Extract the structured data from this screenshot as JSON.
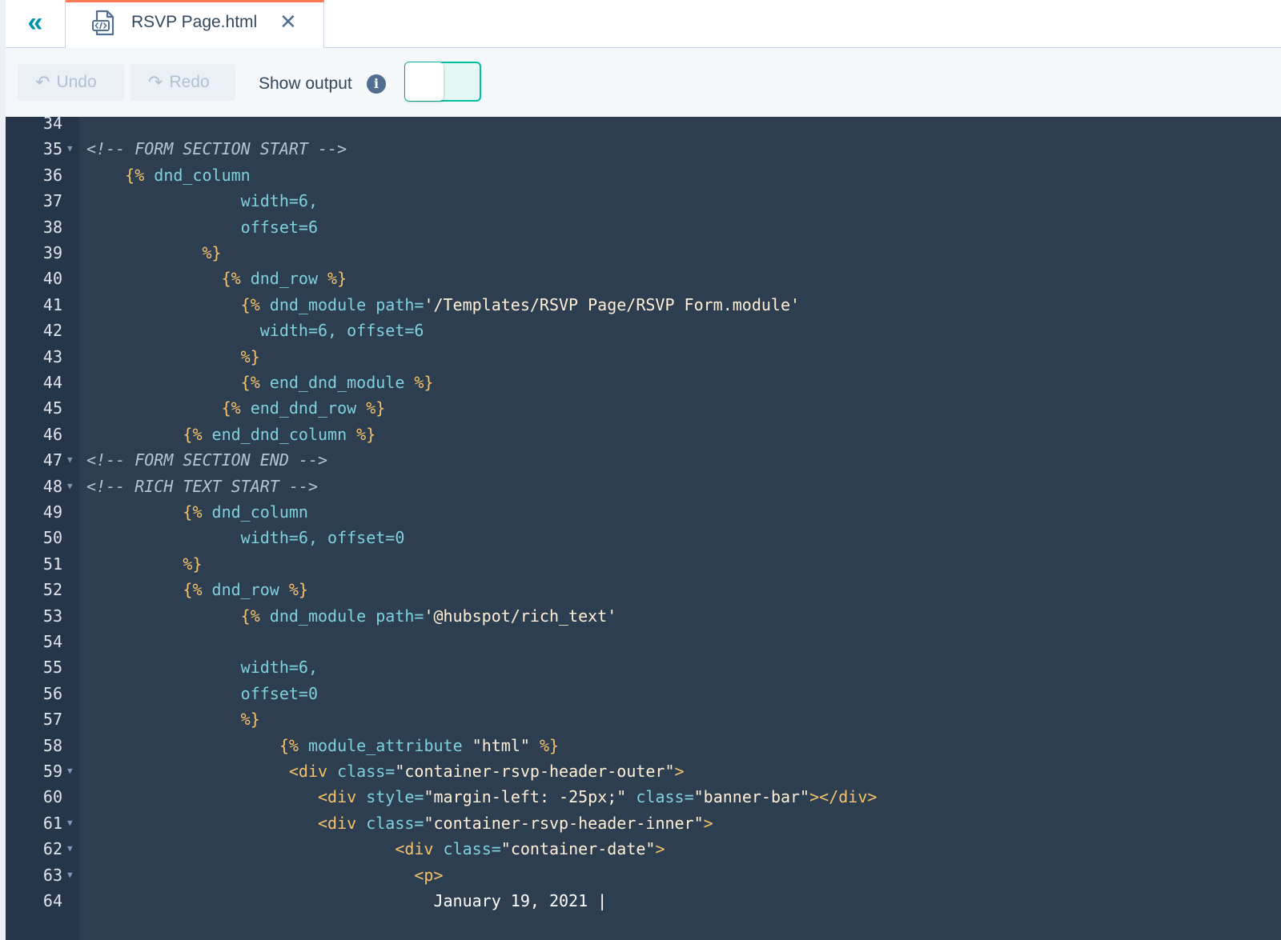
{
  "tab": {
    "title": "RSVP Page.html",
    "close_glyph": "✕",
    "collapse_glyph": "«"
  },
  "toolbar": {
    "undo_label": "Undo",
    "redo_label": "Redo",
    "show_output_label": "Show output",
    "toggle_on": false
  },
  "editor": {
    "lines": [
      {
        "n": "34",
        "fold": false,
        "tokens": []
      },
      {
        "n": "35",
        "fold": true,
        "tokens": [
          {
            "t": "<!-- FORM SECTION START -->",
            "c": "comment"
          }
        ]
      },
      {
        "n": "36",
        "fold": false,
        "tokens": [
          {
            "t": "    {% ",
            "c": "tag"
          },
          {
            "t": "dnd_column",
            "c": "attr"
          }
        ]
      },
      {
        "n": "37",
        "fold": false,
        "tokens": [
          {
            "t": "                width=6,",
            "c": "attr"
          }
        ]
      },
      {
        "n": "38",
        "fold": false,
        "tokens": [
          {
            "t": "                offset=6",
            "c": "attr"
          }
        ]
      },
      {
        "n": "39",
        "fold": false,
        "tokens": [
          {
            "t": "            %}",
            "c": "tag"
          }
        ]
      },
      {
        "n": "40",
        "fold": false,
        "tokens": [
          {
            "t": "              {% ",
            "c": "tag"
          },
          {
            "t": "dnd_row ",
            "c": "attr"
          },
          {
            "t": "%}",
            "c": "tag"
          }
        ]
      },
      {
        "n": "41",
        "fold": false,
        "tokens": [
          {
            "t": "                {% ",
            "c": "tag"
          },
          {
            "t": "dnd_module path=",
            "c": "attr"
          },
          {
            "t": "'/Templates/RSVP Page/RSVP Form.module'",
            "c": "str"
          }
        ]
      },
      {
        "n": "42",
        "fold": false,
        "tokens": [
          {
            "t": "                  width=6, offset=6",
            "c": "attr"
          }
        ]
      },
      {
        "n": "43",
        "fold": false,
        "tokens": [
          {
            "t": "                %}",
            "c": "tag"
          }
        ]
      },
      {
        "n": "44",
        "fold": false,
        "tokens": [
          {
            "t": "                {% ",
            "c": "tag"
          },
          {
            "t": "end_dnd_module ",
            "c": "attr"
          },
          {
            "t": "%}",
            "c": "tag"
          }
        ]
      },
      {
        "n": "45",
        "fold": false,
        "tokens": [
          {
            "t": "              {% ",
            "c": "tag"
          },
          {
            "t": "end_dnd_row ",
            "c": "attr"
          },
          {
            "t": "%}",
            "c": "tag"
          }
        ]
      },
      {
        "n": "46",
        "fold": false,
        "tokens": [
          {
            "t": "          {% ",
            "c": "tag"
          },
          {
            "t": "end_dnd_column ",
            "c": "attr"
          },
          {
            "t": "%}",
            "c": "tag"
          }
        ]
      },
      {
        "n": "47",
        "fold": true,
        "tokens": [
          {
            "t": "<!-- FORM SECTION END -->",
            "c": "comment"
          }
        ]
      },
      {
        "n": "48",
        "fold": true,
        "tokens": [
          {
            "t": "<!-- RICH TEXT START -->",
            "c": "comment"
          }
        ]
      },
      {
        "n": "49",
        "fold": false,
        "tokens": [
          {
            "t": "          {% ",
            "c": "tag"
          },
          {
            "t": "dnd_column",
            "c": "attr"
          }
        ]
      },
      {
        "n": "50",
        "fold": false,
        "tokens": [
          {
            "t": "                width=6, offset=0",
            "c": "attr"
          }
        ]
      },
      {
        "n": "51",
        "fold": false,
        "tokens": [
          {
            "t": "          %}",
            "c": "tag"
          }
        ]
      },
      {
        "n": "52",
        "fold": false,
        "tokens": [
          {
            "t": "          {% ",
            "c": "tag"
          },
          {
            "t": "dnd_row ",
            "c": "attr"
          },
          {
            "t": "%}",
            "c": "tag"
          }
        ]
      },
      {
        "n": "53",
        "fold": false,
        "tokens": [
          {
            "t": "                {% ",
            "c": "tag"
          },
          {
            "t": "dnd_module path=",
            "c": "attr"
          },
          {
            "t": "'@hubspot/rich_text'",
            "c": "str"
          }
        ]
      },
      {
        "n": "54",
        "fold": false,
        "tokens": []
      },
      {
        "n": "55",
        "fold": false,
        "tokens": [
          {
            "t": "                width=6,",
            "c": "attr"
          }
        ]
      },
      {
        "n": "56",
        "fold": false,
        "tokens": [
          {
            "t": "                offset=0",
            "c": "attr"
          }
        ]
      },
      {
        "n": "57",
        "fold": false,
        "tokens": [
          {
            "t": "                %}",
            "c": "tag"
          }
        ]
      },
      {
        "n": "58",
        "fold": false,
        "tokens": [
          {
            "t": "                    {% ",
            "c": "tag"
          },
          {
            "t": "module_attribute ",
            "c": "attr"
          },
          {
            "t": "\"html\" ",
            "c": "str"
          },
          {
            "t": "%}",
            "c": "tag"
          }
        ]
      },
      {
        "n": "59",
        "fold": true,
        "tokens": [
          {
            "t": "                     <div ",
            "c": "tag"
          },
          {
            "t": "class=",
            "c": "attr"
          },
          {
            "t": "\"container-rsvp-header-outer\"",
            "c": "str"
          },
          {
            "t": ">",
            "c": "tag"
          }
        ]
      },
      {
        "n": "60",
        "fold": false,
        "tokens": [
          {
            "t": "                        <div ",
            "c": "tag"
          },
          {
            "t": "style=",
            "c": "attr"
          },
          {
            "t": "\"margin-left: -25px;\" ",
            "c": "str"
          },
          {
            "t": "class=",
            "c": "attr"
          },
          {
            "t": "\"banner-bar\"",
            "c": "str"
          },
          {
            "t": "></div>",
            "c": "tag"
          }
        ]
      },
      {
        "n": "61",
        "fold": true,
        "tokens": [
          {
            "t": "                        <div ",
            "c": "tag"
          },
          {
            "t": "class=",
            "c": "attr"
          },
          {
            "t": "\"container-rsvp-header-inner\"",
            "c": "str"
          },
          {
            "t": ">",
            "c": "tag"
          }
        ]
      },
      {
        "n": "62",
        "fold": true,
        "tokens": [
          {
            "t": "                                <div ",
            "c": "tag"
          },
          {
            "t": "class=",
            "c": "attr"
          },
          {
            "t": "\"container-date\"",
            "c": "str"
          },
          {
            "t": ">",
            "c": "tag"
          }
        ]
      },
      {
        "n": "63",
        "fold": true,
        "tokens": [
          {
            "t": "                                  <p>",
            "c": "tag"
          }
        ]
      },
      {
        "n": "64",
        "fold": false,
        "tokens": [
          {
            "t": "                                    January 19, 2021 |",
            "c": "text"
          }
        ]
      }
    ]
  }
}
